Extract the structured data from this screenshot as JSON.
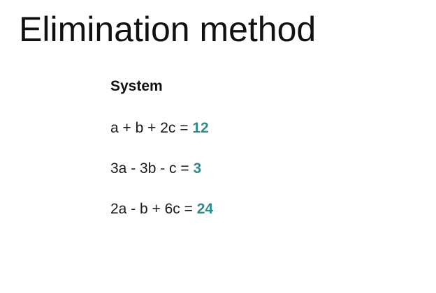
{
  "slide": {
    "title": "Elimination method",
    "system_heading": "System",
    "accent_color": "#2e8b8b",
    "equations": [
      {
        "lhs": "a + b + 2c = ",
        "rhs": "12"
      },
      {
        "lhs": "3a - 3b - c = ",
        "rhs": "3"
      },
      {
        "lhs": "2a - b + 6c = ",
        "rhs": "24"
      }
    ]
  }
}
